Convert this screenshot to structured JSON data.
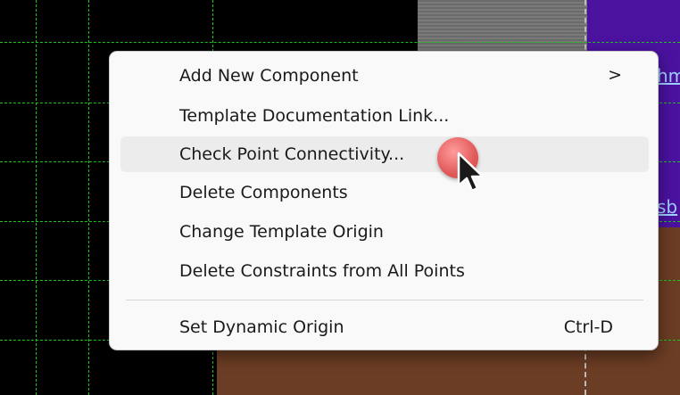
{
  "background": {
    "partial_labels": [
      "hm",
      "sb"
    ],
    "colors": {
      "canvas": "#000000",
      "grid": "#1fc21f",
      "purple": "#4b12a0",
      "brown": "#6b3d24",
      "grey": "#7a7a7a"
    }
  },
  "context_menu": {
    "items": [
      {
        "label": "Add New Component",
        "submenu": ">"
      },
      {
        "label": "Template Documentation Link..."
      },
      {
        "label": "Check Point Connectivity...",
        "state": "hover"
      },
      {
        "label": "Delete Components"
      },
      {
        "label": "Change Template Origin"
      },
      {
        "label": "Delete Constraints from All Points"
      },
      {
        "label": "Set Dynamic Origin",
        "shortcut": "Ctrl-D"
      }
    ]
  },
  "icons": {
    "cursor": "arrow-pointer-icon",
    "click": "click-indicator-icon"
  }
}
